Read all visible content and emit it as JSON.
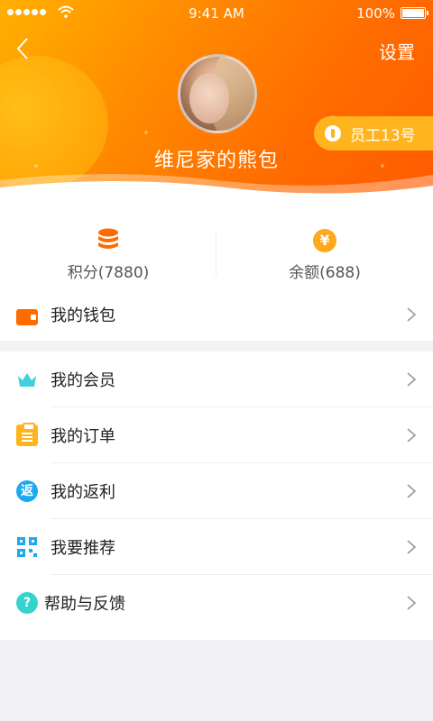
{
  "status_bar": {
    "time": "9:41 AM",
    "battery": "100%"
  },
  "header": {
    "settings_label": "设置",
    "username": "维尼家的熊包",
    "badge_label": "员工13号"
  },
  "stats": {
    "points_label": "积分(7880)",
    "balance_label": "余额(688)",
    "balance_symbol": "¥"
  },
  "menu": {
    "wallet": {
      "label": "我的钱包"
    },
    "items": [
      {
        "label": "我的会员",
        "icon": "crown-icon"
      },
      {
        "label": "我的订单",
        "icon": "clipboard-icon"
      },
      {
        "label": "我的返利",
        "icon": "rebate-icon",
        "icon_char": "返"
      },
      {
        "label": "我要推荐",
        "icon": "qrcode-icon"
      },
      {
        "label": "帮助与反馈",
        "icon": "help-icon",
        "icon_char": "?"
      }
    ]
  },
  "colors": {
    "accent": "#ff6a00",
    "badge": "#ffb41e",
    "blue": "#1ea8f0",
    "teal": "#36d3cd"
  }
}
